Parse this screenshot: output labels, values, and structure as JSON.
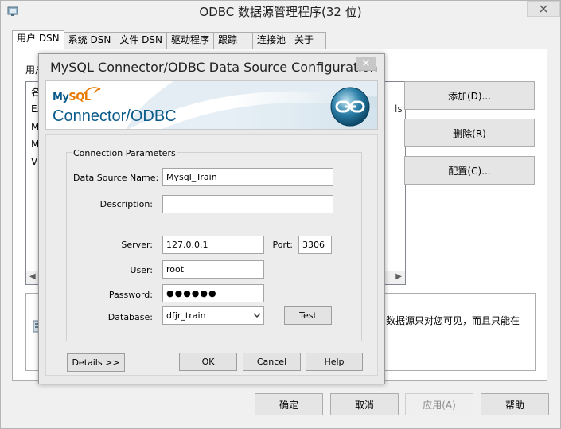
{
  "outer": {
    "title": "ODBC 数据源管理程序(32 位)",
    "tabs": [
      "用户 DSN",
      "系统 DSN",
      "文件 DSN",
      "驱动程序",
      "跟踪",
      "连接池",
      "关于"
    ],
    "panel_label": "用户",
    "list_rows": [
      "名",
      "Ex",
      "M",
      "M",
      "Vi"
    ],
    "cut_text": "ls",
    "side_buttons": {
      "add": "添加(D)...",
      "remove": "删除(R)",
      "configure": "配置(C)..."
    },
    "info_text": "数据源只对您可见，而且只能在",
    "bottom_buttons": {
      "ok": "确定",
      "cancel": "取消",
      "apply": "应用(A)",
      "help": "帮助"
    }
  },
  "dialog": {
    "title": "MySQL Connector/ODBC Data Source Configuration",
    "close_glyph": "✕",
    "logo": {
      "my": "My",
      "sql": "SQL",
      "product": "Connector/ODBC"
    },
    "group_label": "Connection Parameters",
    "labels": {
      "dsn": "Data Source Name:",
      "description": "Description:",
      "server": "Server:",
      "port": "Port:",
      "user": "User:",
      "password": "Password:",
      "database": "Database:"
    },
    "values": {
      "dsn": "Mysql_Train",
      "description": "",
      "server": "127.0.0.1",
      "port": "3306",
      "user": "root",
      "password_mask": "●●●●●●",
      "database": "dfjr_train"
    },
    "buttons": {
      "test": "Test",
      "details": "Details >>",
      "ok": "OK",
      "cancel": "Cancel",
      "help": "Help"
    }
  },
  "icons": [
    "odbc-app-icon",
    "close-icon",
    "chain-link-logo-icon",
    "dropdown-arrow-icon",
    "scroll-left-icon",
    "scroll-right-icon",
    "info-icon"
  ]
}
